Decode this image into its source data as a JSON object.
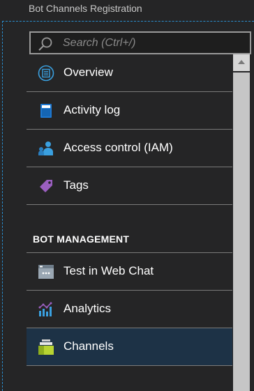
{
  "header": {
    "title": "Bot Channels Registration"
  },
  "search": {
    "placeholder": "Search (Ctrl+/)"
  },
  "menu": {
    "items": [
      {
        "label": "Overview",
        "icon": "overview-icon"
      },
      {
        "label": "Activity log",
        "icon": "activity-log-icon"
      },
      {
        "label": "Access control (IAM)",
        "icon": "access-control-icon"
      },
      {
        "label": "Tags",
        "icon": "tag-icon"
      }
    ],
    "section": "BOT MANAGEMENT",
    "bot_items": [
      {
        "label": "Test in Web Chat",
        "icon": "web-chat-icon"
      },
      {
        "label": "Analytics",
        "icon": "analytics-icon"
      },
      {
        "label": "Channels",
        "icon": "channels-icon",
        "selected": true
      }
    ]
  },
  "colors": {
    "background": "#252526",
    "selected": "#1d3246",
    "accent": "#2a8fd0"
  }
}
